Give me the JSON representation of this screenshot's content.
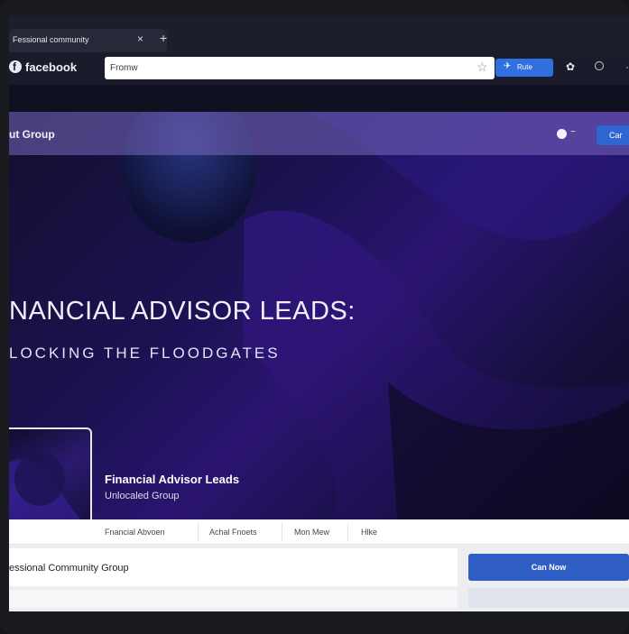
{
  "browser": {
    "tab_title": "Fessional community",
    "tab_close": "×",
    "new_tab": "+",
    "brand": "facebook",
    "address_value": "Fromw",
    "share_label": "Rute"
  },
  "group_bar": {
    "title": "ut Group",
    "cta_label": "Car"
  },
  "hero": {
    "headline": "NANCIAL ADVISOR LEADS:",
    "subheadline": "LOCKING THE FLOODGATES",
    "group_name": "Financial Advisor Leads",
    "group_type": "Unlocaled Group"
  },
  "nav": {
    "items": [
      "Fnancial Abvoen",
      "Achal Fnoets",
      "Mon Mew",
      "Hlke"
    ]
  },
  "content": {
    "card_title": "essional Community Group",
    "join_label": "Can Now"
  },
  "colors": {
    "accent_blue": "#2f5ec5",
    "hero_purple": "#2a1470",
    "group_bar": "#7868be"
  }
}
